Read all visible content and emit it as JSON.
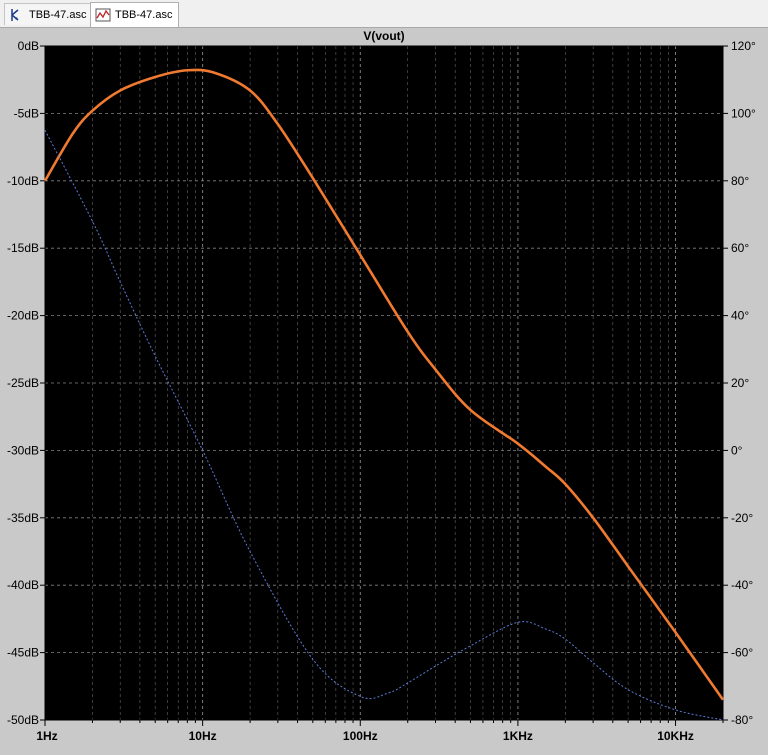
{
  "tabs": [
    {
      "label": "TBB-47.asc",
      "icon": "schematic-icon",
      "active": false
    },
    {
      "label": "TBB-47.asc",
      "icon": "waveform-icon",
      "active": true
    }
  ],
  "colors": {
    "plot_background": "#000000",
    "grid": "#9a9a9a",
    "axis_text": "#000000",
    "magnitude_trace": "#f07a30",
    "phase_trace": "#5a7bd6"
  },
  "chart_data": {
    "type": "line",
    "title": "V(vout)",
    "xscale": "log",
    "xlim": [
      1,
      20000
    ],
    "x_ticks": [
      1,
      10,
      100,
      1000,
      10000
    ],
    "x_tick_labels": [
      "1Hz",
      "10Hz",
      "100Hz",
      "1KHz",
      "10KHz"
    ],
    "y_left_lim": [
      -50,
      0
    ],
    "y_left_ticks": [
      0,
      -5,
      -10,
      -15,
      -20,
      -25,
      -30,
      -35,
      -40,
      -45,
      -50
    ],
    "y_left_tick_labels": [
      "0dB",
      "-5dB",
      "-10dB",
      "-15dB",
      "-20dB",
      "-25dB",
      "-30dB",
      "-35dB",
      "-40dB",
      "-45dB",
      "-50dB"
    ],
    "y_right_lim": [
      -80,
      120
    ],
    "y_right_ticks": [
      120,
      100,
      80,
      60,
      40,
      20,
      0,
      -20,
      -40,
      -60,
      -80
    ],
    "y_right_tick_labels": [
      "120°",
      "100°",
      "80°",
      "60°",
      "40°",
      "20°",
      "0°",
      "-20°",
      "-40°",
      "-60°",
      "-80°"
    ],
    "grid": true,
    "series": [
      {
        "axis": "left",
        "style": "solid",
        "x": [
          1,
          1.5,
          2,
          3,
          5,
          8,
          12,
          20,
          30,
          50,
          100,
          200,
          300,
          500,
          1000,
          1500,
          2000,
          3000,
          5000,
          10000,
          20000
        ],
        "y": [
          -10,
          -6.5,
          -4.8,
          -3.3,
          -2.3,
          -1.8,
          -2.0,
          -3.3,
          -5.8,
          -9.8,
          -15.5,
          -21.2,
          -24.0,
          -27.0,
          -29.5,
          -31.2,
          -32.5,
          -35.0,
          -38.6,
          -43.5,
          -48.5
        ]
      },
      {
        "axis": "right",
        "style": "dotted",
        "x": [
          1,
          2,
          3,
          5,
          10,
          20,
          50,
          100,
          150,
          200,
          300,
          500,
          1000,
          1500,
          2000,
          3000,
          5000,
          10000,
          20000
        ],
        "y": [
          95,
          68,
          50,
          28,
          0,
          -30,
          -62,
          -73,
          -72,
          -69,
          -64,
          -58,
          -51,
          -53,
          -56,
          -63,
          -71,
          -77,
          -80
        ]
      }
    ]
  }
}
